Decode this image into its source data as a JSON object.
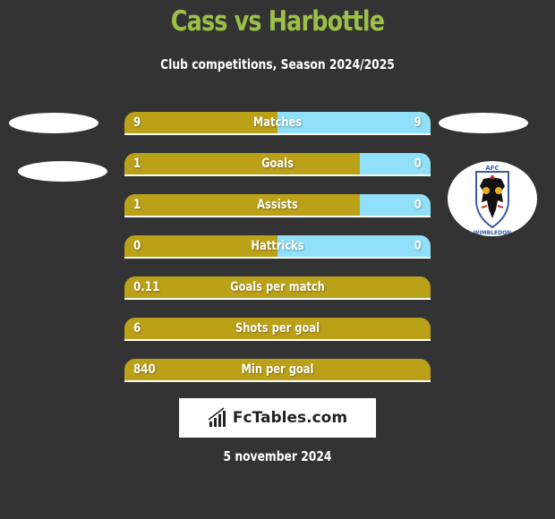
{
  "header": {
    "title": "Cass vs Harbottle",
    "subtitle": "Club competitions, Season 2024/2025"
  },
  "colors": {
    "left_player": "#bba118",
    "right_player": "#8fe0f8",
    "title": "#9bbf47",
    "background": "#333333"
  },
  "right_team_logo": {
    "icon": "afc-wimbledon-crest-icon",
    "top_text": "AFC",
    "bottom_text": "WIMBLEDON"
  },
  "chart_data": {
    "type": "bar",
    "title": "Cass vs Harbottle",
    "subtitle": "Club competitions, Season 2024/2025",
    "series": [
      {
        "name": "Cass",
        "color": "#bba118"
      },
      {
        "name": "Harbottle",
        "color": "#8fe0f8"
      }
    ],
    "rows": [
      {
        "label": "Matches",
        "left": "9",
        "right": "9",
        "left_share": 0.5
      },
      {
        "label": "Goals",
        "left": "1",
        "right": "0",
        "left_share": 0.77
      },
      {
        "label": "Assists",
        "left": "1",
        "right": "0",
        "left_share": 0.77
      },
      {
        "label": "Hattricks",
        "left": "0",
        "right": "0",
        "left_share": 0.5
      },
      {
        "label": "Goals per match",
        "left": "0.11",
        "right": null,
        "left_share": 1.0
      },
      {
        "label": "Shots per goal",
        "left": "6",
        "right": null,
        "left_share": 1.0
      },
      {
        "label": "Min per goal",
        "left": "840",
        "right": null,
        "left_share": 1.0
      }
    ]
  },
  "footer": {
    "brand": "FcTables.com",
    "brand_icon": "bar-chart-icon",
    "date": "5 november 2024"
  }
}
